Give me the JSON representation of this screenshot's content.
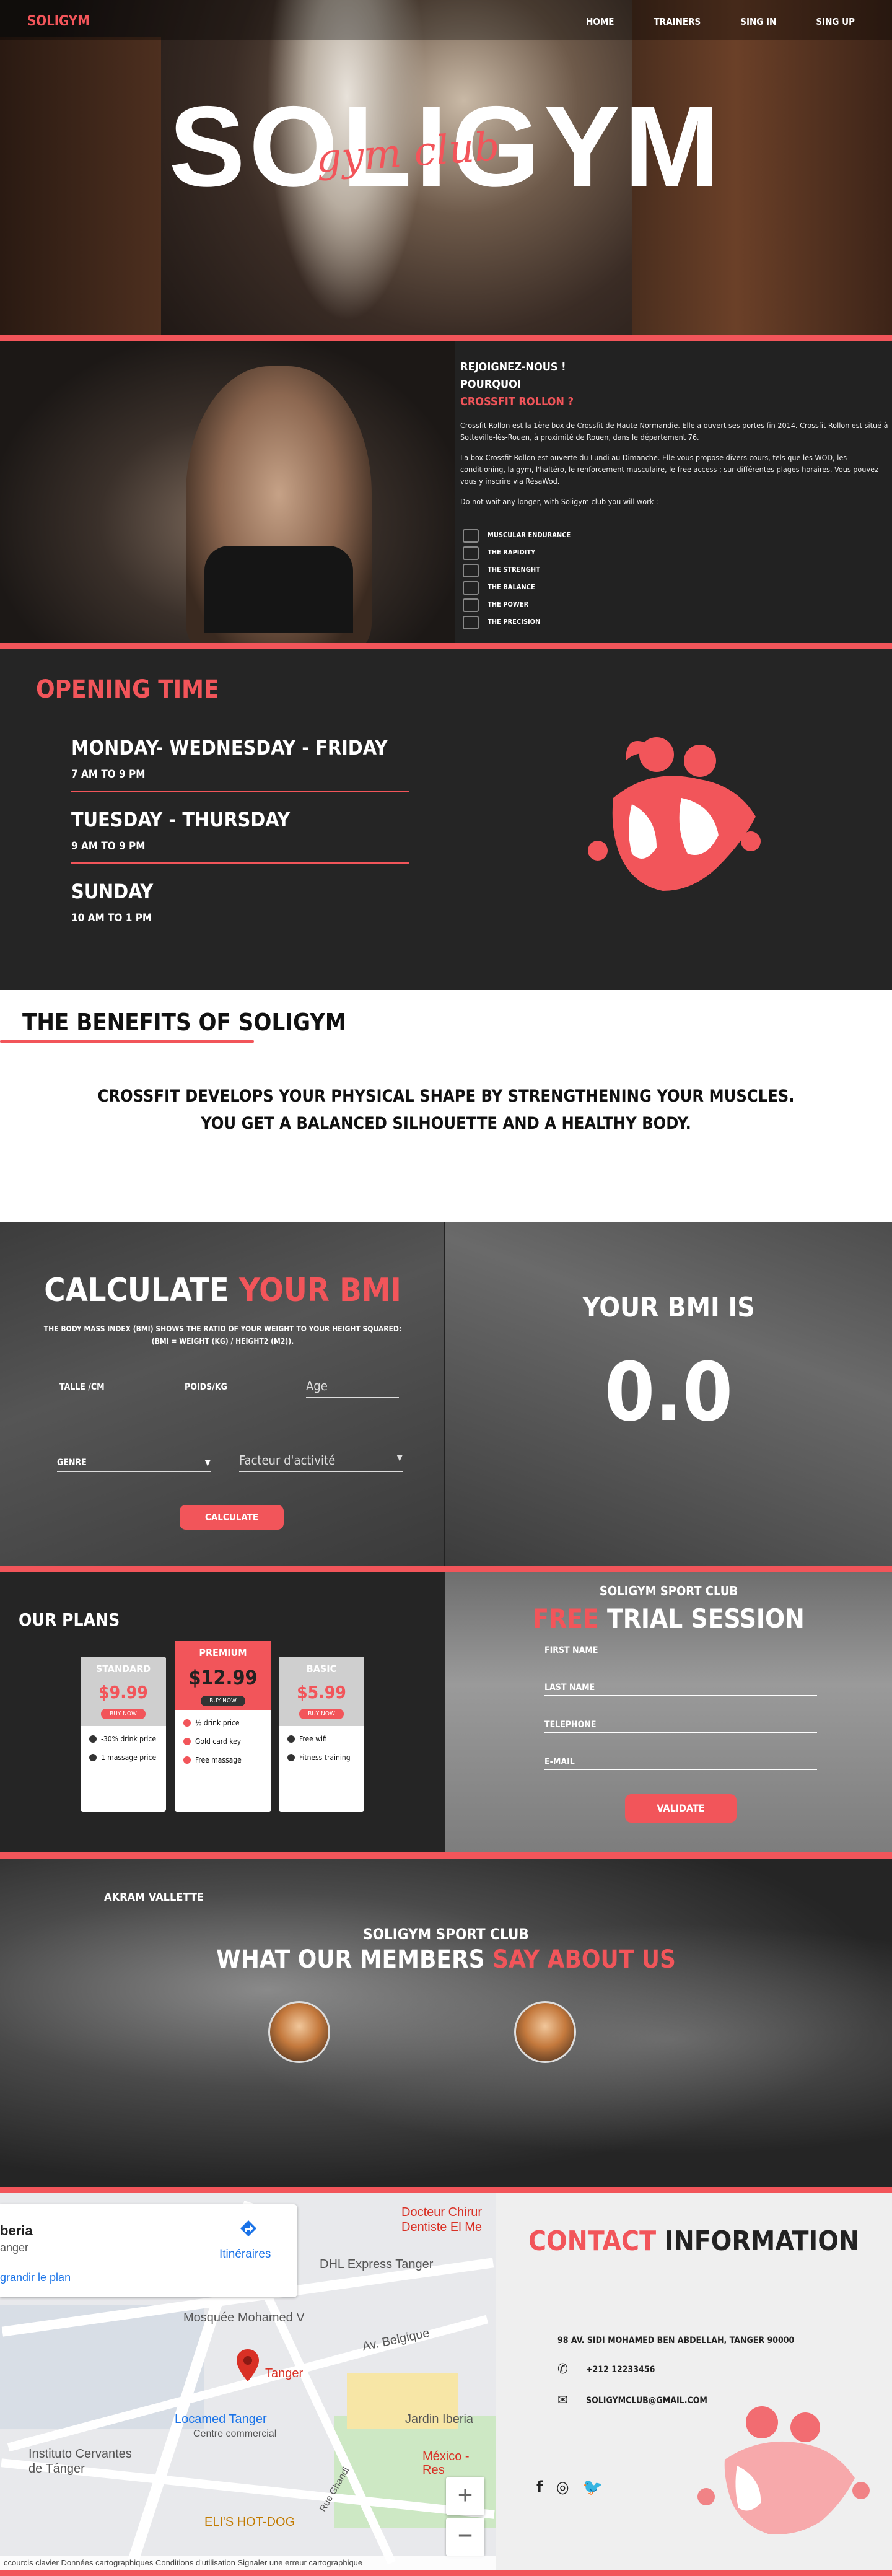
{
  "nav": {
    "logo": "SOLIGYM",
    "items": [
      "HOME",
      "TRAINERS",
      "SING IN",
      "SING UP"
    ]
  },
  "hero": {
    "title": "SOLIGYM",
    "subtitle": "gym club"
  },
  "join": {
    "line1": "REJOIGNEZ-NOUS !",
    "line2": "POURQUOI",
    "line3": "CROSSFIT ROLLON ?",
    "p1": "Crossfit Rollon est la 1ère box de Crossfit de Haute Normandie. Elle a ouvert ses portes fin 2014. Crossfit Rollon est situé à Sotteville-lès-Rouen, à proximité de Rouen, dans le département 76.",
    "p2": "La box Crossfit Rollon est ouverte du Lundi au Dimanche. Elle vous propose divers cours, tels que les WOD, les conditioning, la gym, l'haltéro, le renforcement musculaire, le free access ; sur différentes plages horaires. Vous pouvez vous y inscrire via RésaWod.",
    "p3": "Do not wait any longer, with Soligym club you will work :",
    "works": [
      "MUSCULAR ENDURANCE",
      "THE RAPIDITY",
      "THE STRENGHT",
      "THE BALANCE",
      "THE POWER",
      "THE PRECISION"
    ]
  },
  "opening": {
    "title": "OPENING TIME",
    "slots": [
      {
        "days": "MONDAY- WEDNESDAY - FRIDAY",
        "time": "7 AM TO 9 PM"
      },
      {
        "days": "TUESDAY - THURSDAY",
        "time": "9 AM TO 9 PM"
      },
      {
        "days": "SUNDAY",
        "time": "10 AM TO 1 PM"
      }
    ]
  },
  "benefits": {
    "title": "THE BENEFITS OF SOLIGYM",
    "line1": "CROSSFIT DEVELOPS YOUR PHYSICAL SHAPE BY STRENGTHENING YOUR MUSCLES.",
    "line2": "YOU GET A BALANCED SILHOUETTE AND A HEALTHY BODY."
  },
  "bmi": {
    "title_white": "CALCULATE",
    "title_red": "YOUR BMI",
    "desc1": "THE BODY MASS INDEX (BMI) SHOWS THE RATIO OF YOUR WEIGHT TO YOUR HEIGHT SQUARED:",
    "desc2": "(BMI = WEIGHT (KG) / HEIGHT2 (M2)).",
    "size_label": "TALLE /CM",
    "weight_label": "POIDS/KG",
    "age_placeholder": "Age",
    "gender_label": "GENRE",
    "activity_placeholder": "Facteur d'activité",
    "button": "CALCULATE",
    "result_title": "YOUR BMI IS",
    "result_value": "0.0"
  },
  "plans": {
    "title": "OUR PLANS",
    "cards": [
      {
        "name": "STANDARD",
        "price": "$9.99",
        "buy": "BUY NOW",
        "features": [
          "-30% drink price",
          "1 massage price"
        ]
      },
      {
        "name": "PREMIUM",
        "price": "$12.99",
        "buy": "BUY NOW",
        "features": [
          "½ drink price",
          "Gold card key",
          "Free massage"
        ]
      },
      {
        "name": "BASIC",
        "price": "$5.99",
        "buy": "BUY NOW",
        "features": [
          "Free wifi",
          "Fitness training"
        ]
      }
    ]
  },
  "trial": {
    "club": "SOLIGYM SPORT CLUB",
    "title_red": "FREE",
    "title_white": "TRIAL SESSION",
    "fields": [
      "FIRST NAME",
      "LAST NAME",
      "TELEPHONE",
      "E-MAIL"
    ],
    "button": "VALIDATE"
  },
  "testimonials": {
    "name": "AKRAM VALLETTE",
    "club": "SOLIGYM SPORT CLUB",
    "title_white": "WHAT OUR MEMBERS",
    "title_red": "SAY ABOUT US"
  },
  "map": {
    "place": "beria",
    "city": "anger",
    "enlarge": "grandir le plan",
    "directions": "Itinéraires",
    "labels": [
      "Docteur Chirur",
      "Dentiste El Me",
      "DHL Express Tanger",
      "Mosquée Mohamed V",
      "Av. Belgique",
      "Tanger",
      "Locamed Tanger",
      "Centre commercial",
      "Jardin Iberia",
      "Instituto Cervantes",
      "de Tánger",
      "México -",
      "Res",
      "ELI'S HOT-DOG",
      "Rue Ghandi"
    ],
    "zoom_in": "+",
    "zoom_out": "−",
    "footer": "ccourcis clavier   Données cartographiques   Conditions d'utilisation   Signaler une erreur cartographique"
  },
  "contact": {
    "title_red": "CONTACT",
    "title_dark": "INFORMATION",
    "address": "98 AV. SIDI MOHAMED BEN ABDELLAH, TANGER 90000",
    "phone": "+212 12233456",
    "email": "SOLIGYMCLUB@GMAIL.COM",
    "socials": [
      "f",
      "◎",
      "🐦"
    ]
  },
  "colors": {
    "accent": "#f2555a",
    "dark": "#252525"
  }
}
